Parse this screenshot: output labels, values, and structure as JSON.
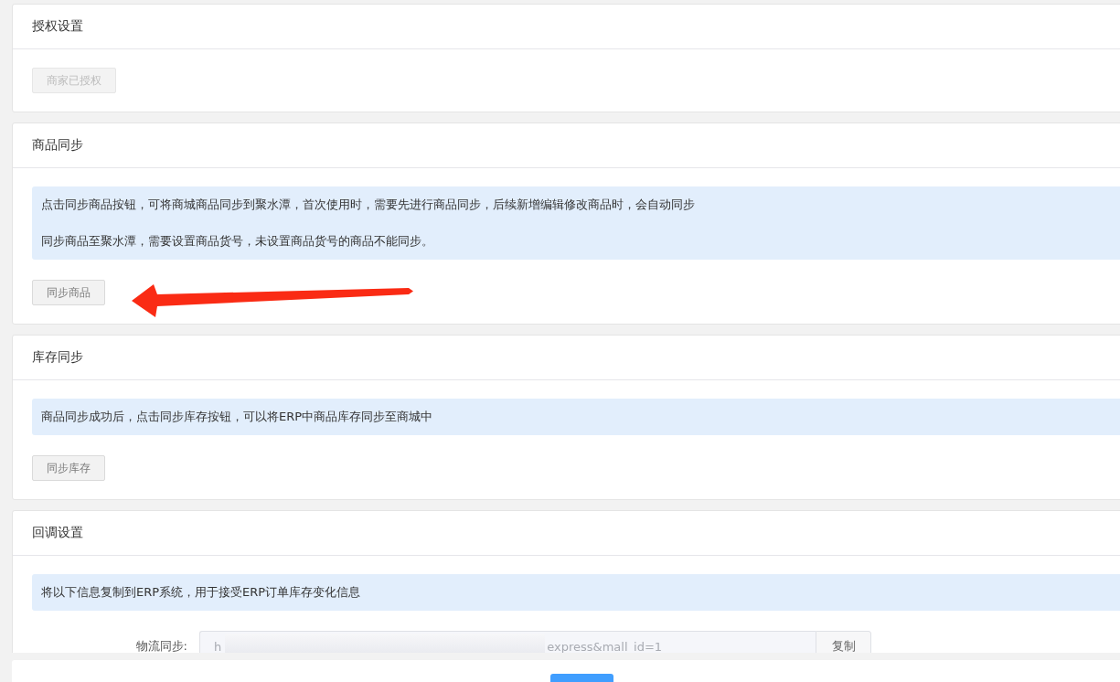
{
  "sections": [
    {
      "title": "授权设置",
      "buttons": [
        {
          "label": "商家已授权",
          "disabled": true,
          "arrow": false
        }
      ]
    },
    {
      "title": "商品同步",
      "notices": [
        "点击同步商品按钮，可将商城商品同步到聚水潭，首次使用时，需要先进行商品同步，后续新增编辑修改商品时，会自动同步",
        "同步商品至聚水潭，需要设置商品货号，未设置商品货号的商品不能同步。"
      ],
      "buttons": [
        {
          "label": "同步商品",
          "disabled": false,
          "arrow": true
        }
      ]
    },
    {
      "title": "库存同步",
      "notices": [
        "商品同步成功后，点击同步库存按钮，可以将ERP中商品库存同步至商城中"
      ],
      "buttons": [
        {
          "label": "同步库存",
          "disabled": false,
          "arrow": false
        }
      ]
    },
    {
      "title": "回调设置",
      "notices": [
        "将以下信息复制到ERP系统，用于接受ERP订单库存变化信息"
      ],
      "fields": [
        {
          "label": "物流同步:",
          "value_parts": [
            "h",
            "express&mall_id=1"
          ],
          "redacted": true,
          "button": "复制"
        }
      ]
    }
  ],
  "footer": {
    "primary_button": true
  }
}
